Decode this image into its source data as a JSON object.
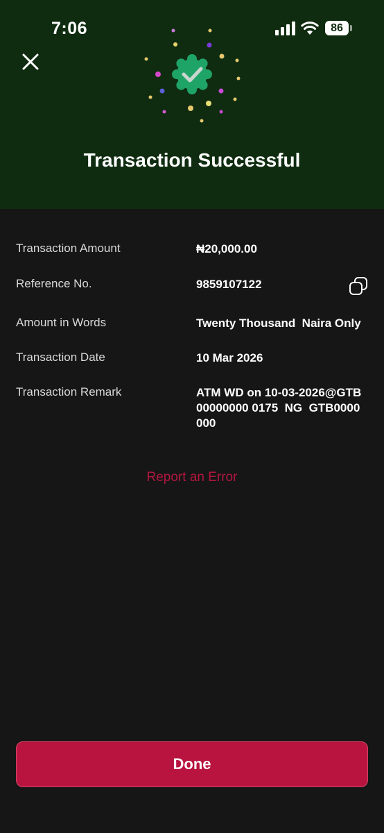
{
  "status_bar": {
    "time": "7:06",
    "battery_level": "86",
    "icons": [
      "signal-icon",
      "wifi-icon",
      "battery-icon"
    ]
  },
  "header": {
    "title": "Transaction Successful",
    "icons": [
      "close-icon",
      "verified-check-icon"
    ],
    "accent_colors": {
      "header_bg": "#0f2c10",
      "badge": "#1fa467"
    }
  },
  "details": {
    "rows": [
      {
        "label": "Transaction Amount",
        "value": "₦20,000.00"
      },
      {
        "label": "Reference No.",
        "value": "9859107122"
      },
      {
        "label": "Amount in Words",
        "value": "Twenty Thousand  Naira Only"
      },
      {
        "label": "Transaction Date",
        "value": "10 Mar 2026"
      },
      {
        "label": "Transaction Remark",
        "value": "ATM WD on 10-03-2026@GTB00000000 0175  NG  GTB0000000"
      }
    ],
    "copy_icon": "copy-icon"
  },
  "actions": {
    "report_label": "Report an Error",
    "done_label": "Done",
    "accent_color": "#b8143f"
  }
}
